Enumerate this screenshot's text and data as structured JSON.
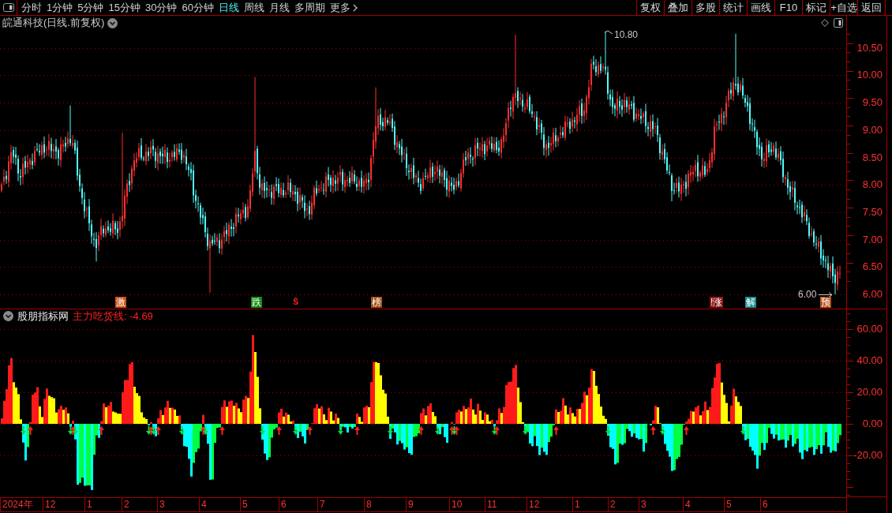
{
  "toolbar": {
    "periods": [
      {
        "label": "分时",
        "kind": "period",
        "selected": false
      },
      {
        "label": "1分钟",
        "kind": "period",
        "selected": false
      },
      {
        "label": "5分钟",
        "kind": "period",
        "selected": false
      },
      {
        "label": "15分钟",
        "kind": "period",
        "selected": false
      },
      {
        "label": "30分钟",
        "kind": "period",
        "selected": false
      },
      {
        "label": "60分钟",
        "kind": "period",
        "selected": false
      },
      {
        "label": "日线",
        "kind": "period",
        "selected": true
      },
      {
        "label": "周线",
        "kind": "period",
        "selected": false
      },
      {
        "label": "月线",
        "kind": "period",
        "selected": false
      },
      {
        "label": "多周期",
        "kind": "period",
        "selected": false
      },
      {
        "label": "更多",
        "kind": "menu",
        "selected": false
      }
    ],
    "buttons": [
      "复权",
      "叠加",
      "多股",
      "统计",
      "画线",
      "F10",
      "标记",
      "+自选",
      "返回"
    ]
  },
  "price_panel": {
    "title": "皖通科技(日线.前复权)",
    "high_label": "10.80",
    "low_label": "6.00",
    "markers": [
      {
        "text": "激",
        "kind": "badge",
        "color": "#c8501a"
      },
      {
        "text": "跌",
        "kind": "badge",
        "color": "#138a13"
      },
      {
        "text": "ŝ",
        "kind": "plain",
        "color": "#ff2020"
      },
      {
        "text": "榜",
        "kind": "badge",
        "color": "#a0501a"
      },
      {
        "text": "!涨",
        "kind": "badge",
        "color": "#8c1414"
      },
      {
        "text": "解",
        "kind": "badge",
        "color": "#138c8c"
      },
      {
        "text": "预",
        "kind": "badge",
        "color": "#b8501a"
      }
    ],
    "axis": [
      "10.50",
      "10.00",
      "9.50",
      "9.00",
      "8.50",
      "8.00",
      "7.50",
      "7.00",
      "6.50",
      "6.00"
    ]
  },
  "indicator_panel": {
    "name": "股朋指标网",
    "value_label": "主力吃货线: -4.69",
    "axis": [
      "60.00",
      "40.00",
      "20.00",
      "0.00",
      "-20.00"
    ]
  },
  "time_axis": [
    "2024年",
    "12",
    "1",
    "2",
    "3",
    "4",
    "5",
    "6",
    "7",
    "8",
    "9",
    "10",
    "11",
    "12",
    "1",
    "2",
    "3",
    "4",
    "5",
    "6"
  ]
}
